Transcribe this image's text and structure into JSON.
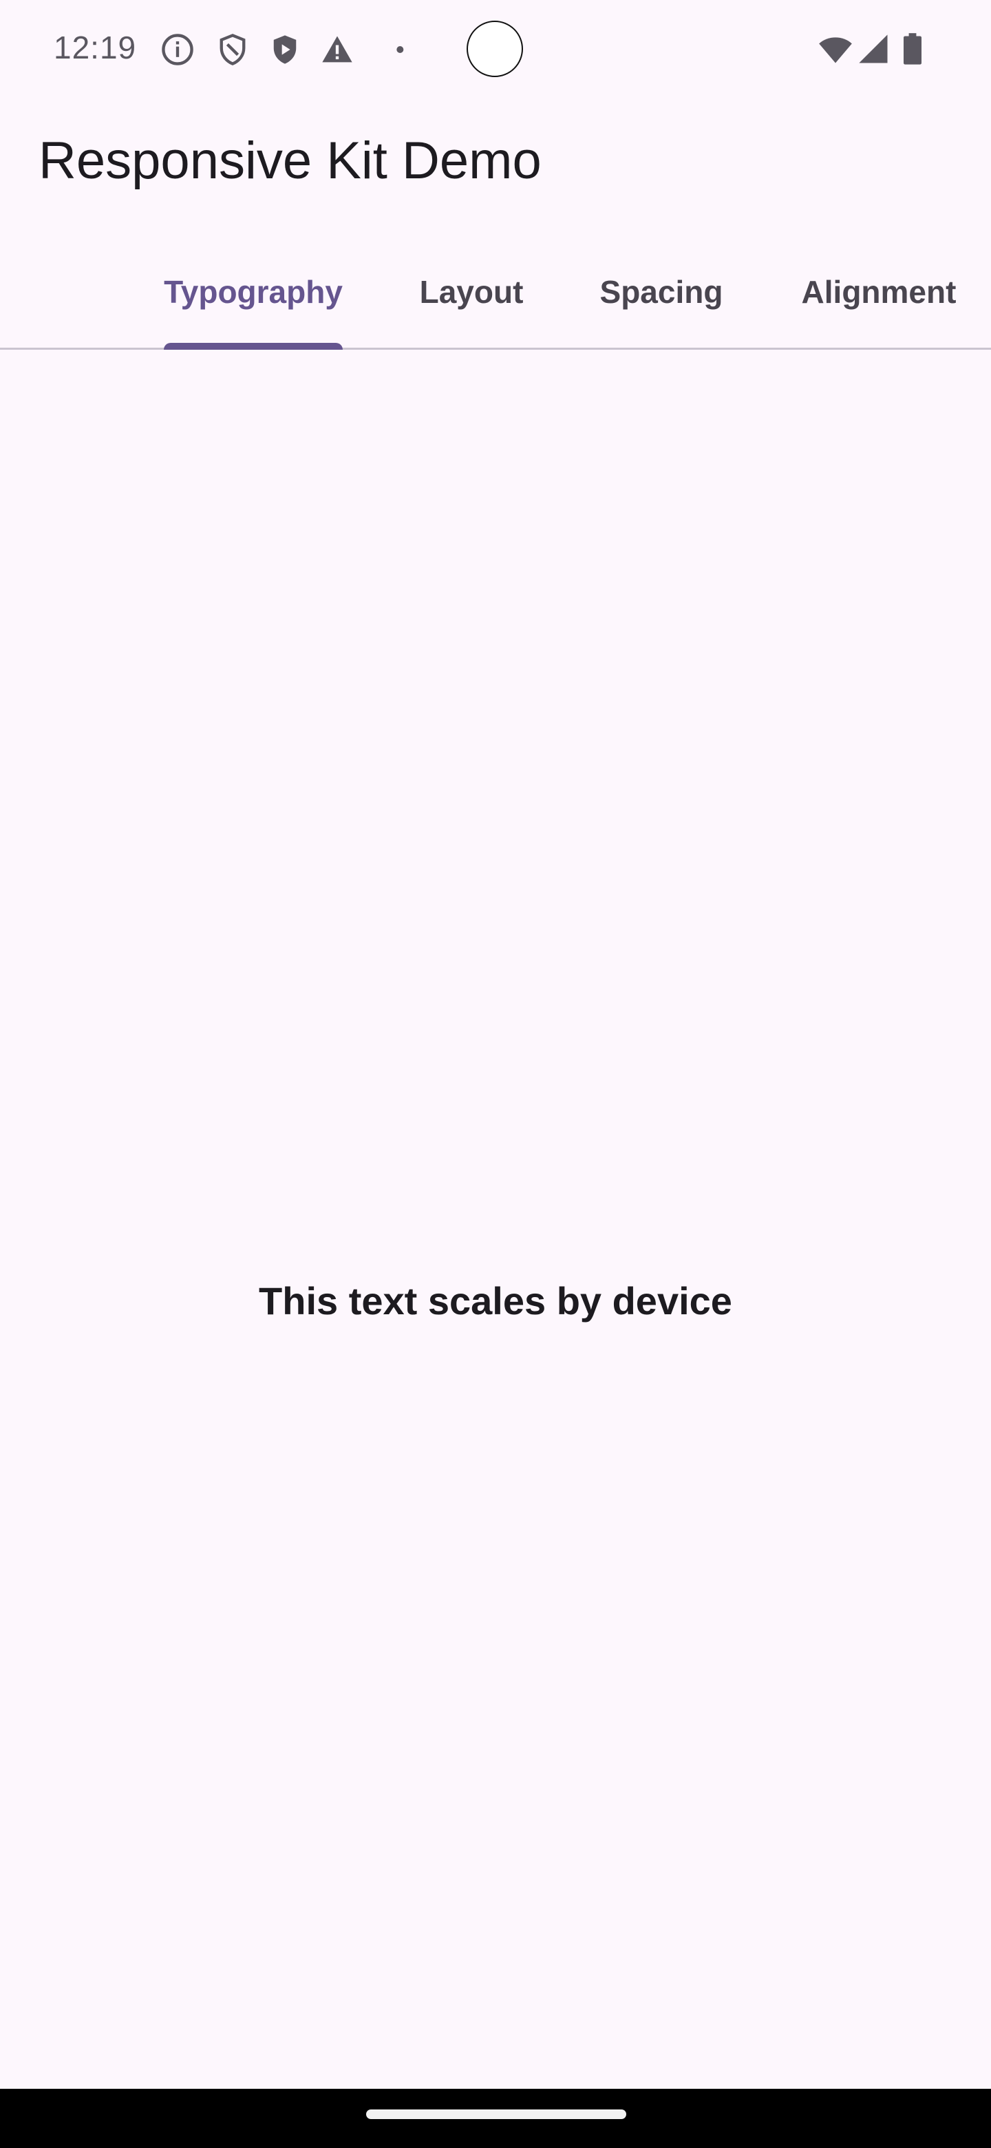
{
  "status_bar": {
    "time": "12:19",
    "icons": [
      "info-icon",
      "shield-outline-icon",
      "shield-play-icon",
      "warning-icon",
      "dot-icon",
      "wifi-icon",
      "signal-icon",
      "battery-icon"
    ]
  },
  "app_bar": {
    "title": "Responsive Kit Demo"
  },
  "tabs": [
    {
      "label": "Typography",
      "selected": true
    },
    {
      "label": "Layout",
      "selected": false
    },
    {
      "label": "Spacing",
      "selected": false
    },
    {
      "label": "Alignment",
      "selected": false
    }
  ],
  "content": {
    "text": "This text scales by device"
  },
  "colors": {
    "background": "#fdf7fd",
    "accent": "#65558f",
    "text_primary": "#1d1b20",
    "text_secondary": "#49454f",
    "divider": "#cac4d0"
  }
}
